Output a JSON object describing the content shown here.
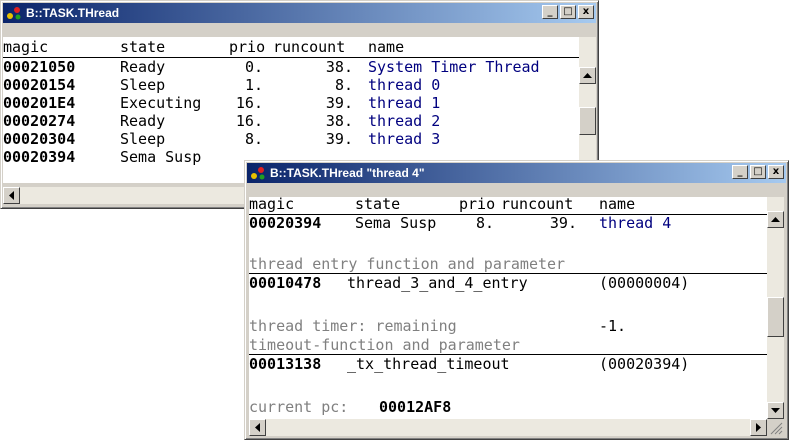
{
  "window1": {
    "title": "B::TASK.THread",
    "buttons": {
      "minimize": "_",
      "maximize": "□",
      "close": "x"
    },
    "columns": [
      "magic",
      "state",
      "prio",
      "runcount",
      "name"
    ],
    "rows": [
      {
        "magic": "00021050",
        "state": "Ready",
        "prio": "0.",
        "runcount": "38.",
        "name": "System Timer Thread"
      },
      {
        "magic": "00020154",
        "state": "Sleep",
        "prio": "1.",
        "runcount": "8.",
        "name": "thread 0"
      },
      {
        "magic": "000201E4",
        "state": "Executing",
        "prio": "16.",
        "runcount": "39.",
        "name": "thread 1"
      },
      {
        "magic": "00020274",
        "state": "Ready",
        "prio": "16.",
        "runcount": "38.",
        "name": "thread 2"
      },
      {
        "magic": "00020304",
        "state": "Sleep",
        "prio": "8.",
        "runcount": "39.",
        "name": "thread 3"
      },
      {
        "magic": "00020394",
        "state": "Sema Susp",
        "prio": "",
        "runcount": "",
        "name": ""
      }
    ]
  },
  "window2": {
    "title": "B::TASK.THread \"thread 4\"",
    "buttons": {
      "minimize": "_",
      "maximize": "□",
      "close": "x"
    },
    "columns": [
      "magic",
      "state",
      "prio",
      "runcount",
      "name"
    ],
    "row": {
      "magic": "00020394",
      "state": "Sema Susp",
      "prio": "8.",
      "runcount": "39.",
      "name": "thread 4"
    },
    "entry_label": "thread entry function and parameter",
    "entry_addr": "00010478",
    "entry_func": "thread_3_and_4_entry",
    "entry_param": "(00000004)",
    "timer_label": "thread timer: remaining",
    "timer_value": "-1.",
    "timeout_label": "timeout-function and parameter",
    "timeout_addr": "00013138",
    "timeout_func": "_tx_thread_timeout",
    "timeout_param": "(00020394)",
    "pc_label": "current pc:",
    "pc_value": "00012AF8"
  },
  "icons": {
    "app": "trace32-app-icon",
    "up": "arrow-up-icon",
    "down": "arrow-down-icon",
    "left": "arrow-left-icon",
    "right": "arrow-right-icon"
  }
}
